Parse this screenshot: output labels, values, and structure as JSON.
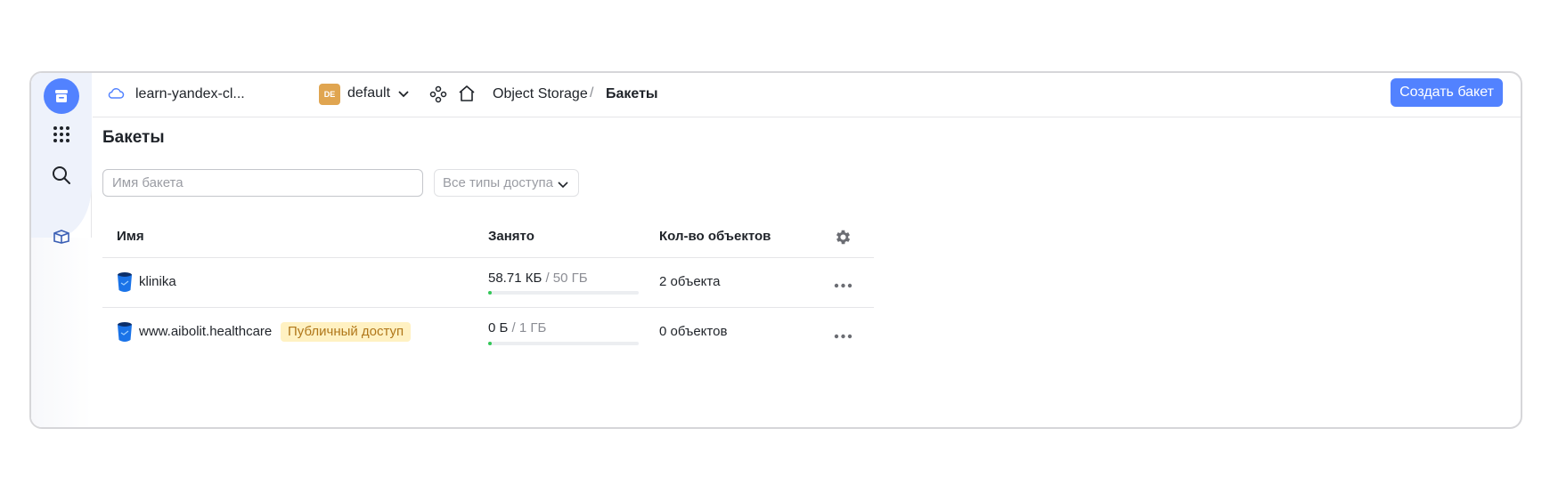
{
  "topbar": {
    "cloud_name": "learn-yandex-cl...",
    "folder_badge": "DE",
    "folder_name": "default",
    "breadcrumb_service": "Object Storage",
    "breadcrumb_separator": "/",
    "breadcrumb_current": "Бакеты",
    "create_button": "Создать бакет"
  },
  "page": {
    "title": "Бакеты",
    "search_placeholder": "Имя бакета",
    "search_value": "",
    "access_filter": "Все типы доступа"
  },
  "table": {
    "headers": {
      "name": "Имя",
      "used": "Занято",
      "objects": "Кол-во объектов"
    },
    "rows": [
      {
        "name": "klinika",
        "badge": "",
        "used": "58.71 КБ",
        "total": " / 50 ГБ",
        "usage_fraction": 1.1e-06,
        "objects": "2 объекта"
      },
      {
        "name": "www.aibolit.healthcare",
        "badge": "Публичный доступ",
        "used": "0 Б",
        "total": " / 1 ГБ",
        "usage_fraction": 0,
        "objects": "0 объектов"
      }
    ]
  },
  "colors": {
    "accent": "#5282ff",
    "usage_bar": "#33c758",
    "badge_bg": "#fff1c2",
    "badge_text": "#b0771a"
  },
  "icons": {
    "rail": [
      "object-storage-logo-icon",
      "all-services-grid-icon",
      "search-icon",
      "package-icon"
    ],
    "topbar": [
      "cloud-icon",
      "chevron-down-icon",
      "services-icon",
      "home-icon"
    ],
    "table": [
      "settings-gear-icon",
      "bucket-icon",
      "more-dots-icon"
    ]
  }
}
